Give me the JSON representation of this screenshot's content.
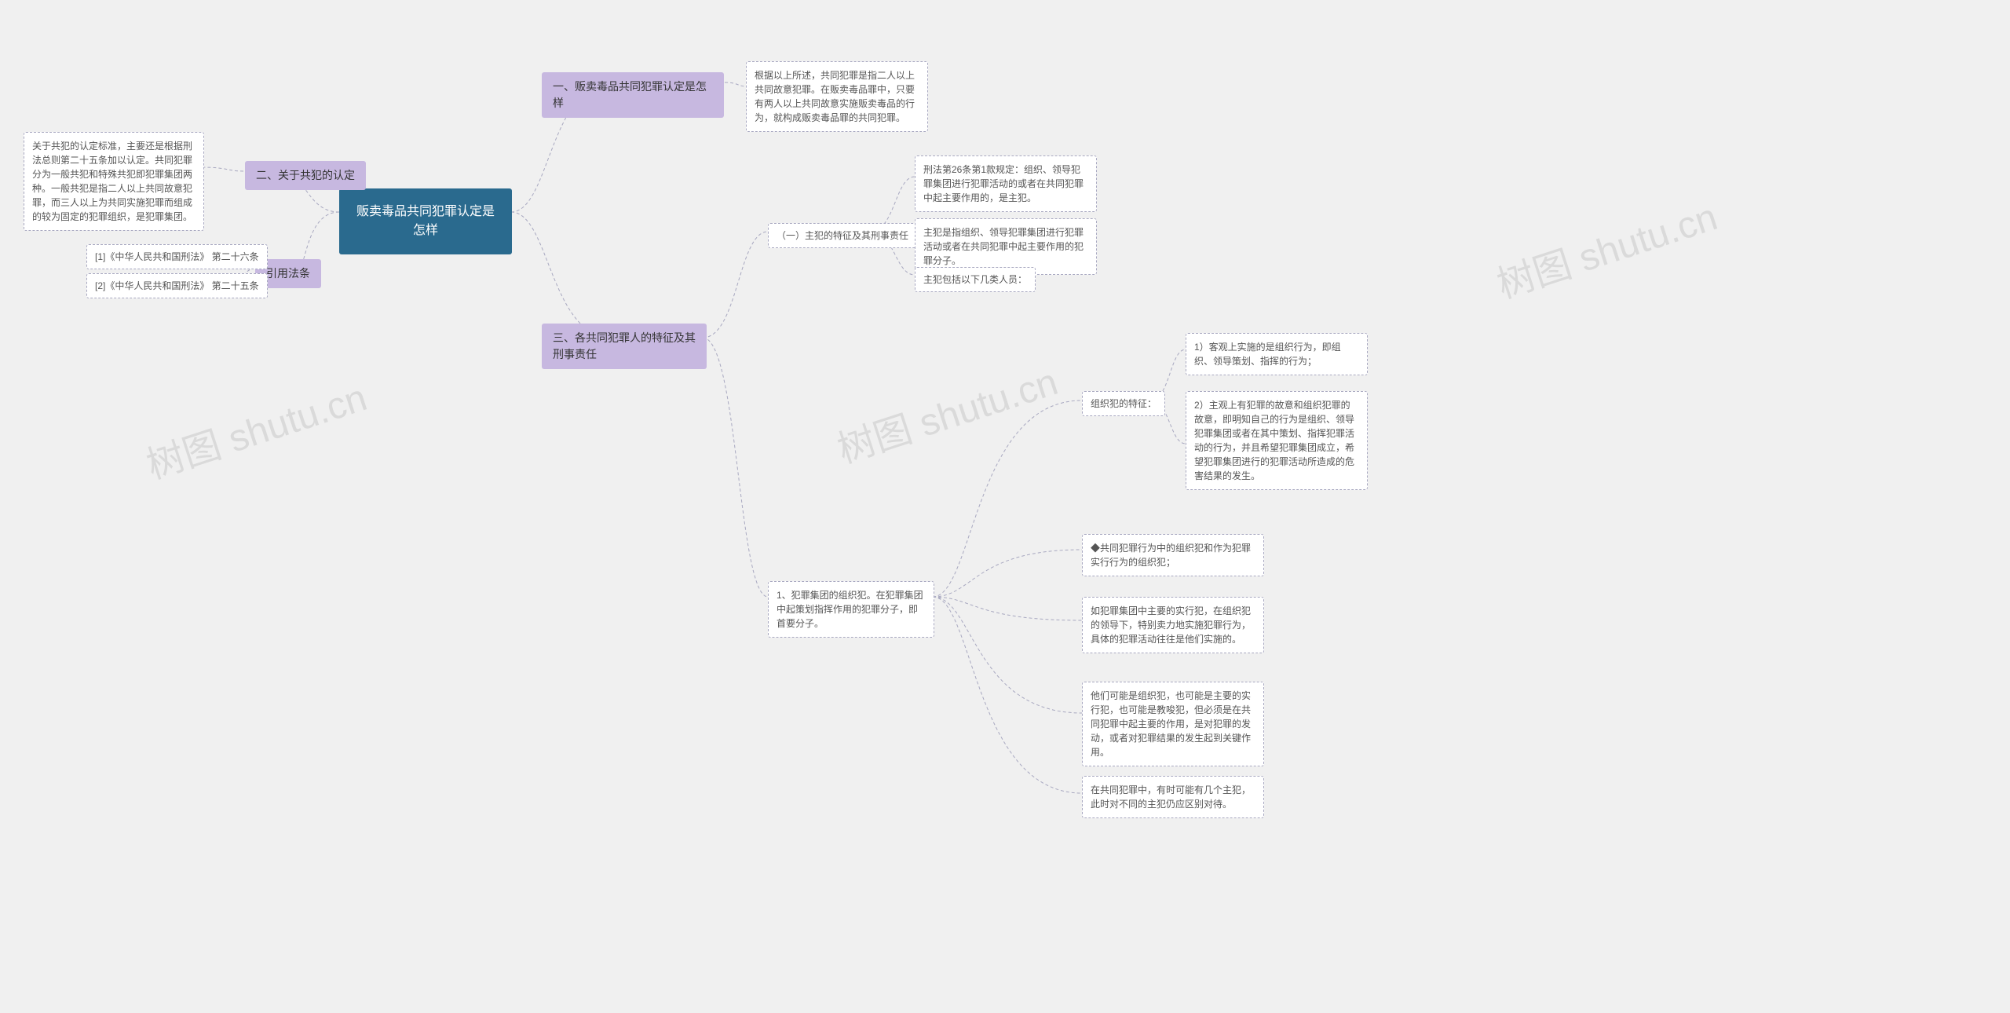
{
  "watermark": "树图 shutu.cn",
  "root": {
    "title": "贩卖毒品共同犯罪认定是怎样"
  },
  "left": {
    "section2": {
      "label": "二、关于共犯的认定",
      "text": "关于共犯的认定标准，主要还是根据刑法总则第二十五条加以认定。共同犯罪分为一般共犯和特殊共犯即犯罪集团两种。一般共犯是指二人以上共同故意犯罪，而三人以上为共同实施犯罪而组成的较为固定的犯罪组织，是犯罪集团。"
    },
    "refs": {
      "label": "引用法条",
      "items": [
        "[1]《中华人民共和国刑法》 第二十六条",
        "[2]《中华人民共和国刑法》 第二十五条"
      ]
    }
  },
  "right": {
    "section1": {
      "label": "一、贩卖毒品共同犯罪认定是怎样",
      "text": "根据以上所述，共同犯罪是指二人以上共同故意犯罪。在贩卖毒品罪中，只要有两人以上共同故意实施贩卖毒品的行为，就构成贩卖毒品罪的共同犯罪。"
    },
    "section3": {
      "label": "三、各共同犯罪人的特征及其刑事责任",
      "sub1": {
        "label": "（一）主犯的特征及其刑事责任",
        "items": [
          "刑法第26条第1款规定：组织、领导犯罪集团进行犯罪活动的或者在共同犯罪中起主要作用的，是主犯。",
          "主犯是指组织、领导犯罪集团进行犯罪活动或者在共同犯罪中起主要作用的犯罪分子。",
          "主犯包括以下几类人员："
        ]
      },
      "sub2": {
        "label": "1、犯罪集团的组织犯。在犯罪集团中起策划指挥作用的犯罪分子，即首要分子。",
        "org_label": "组织犯的特征：",
        "org_items": [
          "1）客观上实施的是组织行为，即组织、领导策划、指挥的行为；",
          "2）主观上有犯罪的故意和组织犯罪的故意，即明知自己的行为是组织、领导犯罪集团或者在其中策划、指挥犯罪活动的行为，并且希望犯罪集团成立，希望犯罪集团进行的犯罪活动所造成的危害结果的发生。"
        ],
        "tail_items": [
          "◆共同犯罪行为中的组织犯和作为犯罪实行行为的组织犯；",
          "如犯罪集团中主要的实行犯，在组织犯的领导下，特别卖力地实施犯罪行为，具体的犯罪活动往往是他们实施的。",
          "他们可能是组织犯，也可能是主要的实行犯，也可能是教唆犯，但必须是在共同犯罪中起主要的作用，是对犯罪的发动，或者对犯罪结果的发生起到关键作用。",
          "在共同犯罪中，有时可能有几个主犯，此时对不同的主犯仍应区别对待。"
        ]
      }
    }
  }
}
